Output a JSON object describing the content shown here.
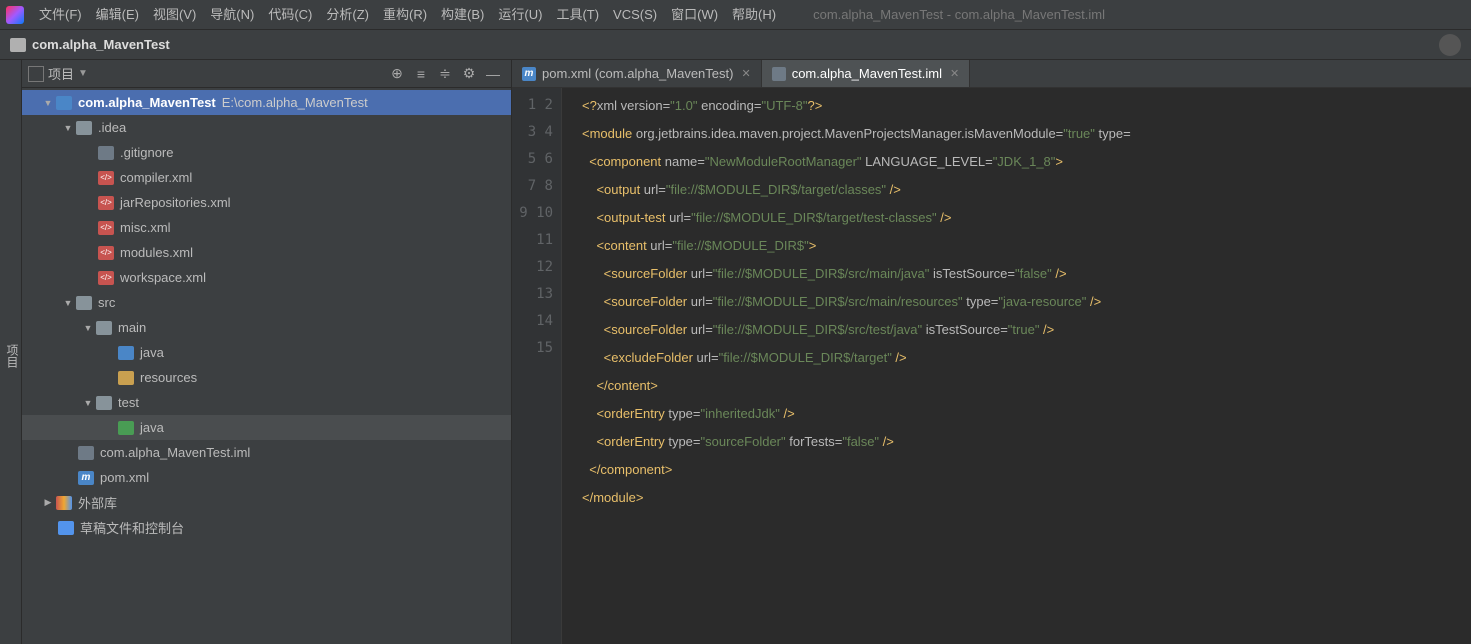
{
  "window_title": "com.alpha_MavenTest - com.alpha_MavenTest.iml",
  "menu": [
    "文件(F)",
    "编辑(E)",
    "视图(V)",
    "导航(N)",
    "代码(C)",
    "分析(Z)",
    "重构(R)",
    "构建(B)",
    "运行(U)",
    "工具(T)",
    "VCS(S)",
    "窗口(W)",
    "帮助(H)"
  ],
  "breadcrumb": "com.alpha_MavenTest",
  "sidebar": {
    "header_label": "项目",
    "gutter_label": "项目"
  },
  "tree": {
    "root_label": "com.alpha_MavenTest",
    "root_path": "E:\\com.alpha_MavenTest",
    "idea": ".idea",
    "gitignore": ".gitignore",
    "compiler": "compiler.xml",
    "jarrepo": "jarRepositories.xml",
    "misc": "misc.xml",
    "modules": "modules.xml",
    "workspace": "workspace.xml",
    "src": "src",
    "main": "main",
    "java": "java",
    "resources": "resources",
    "test": "test",
    "java2": "java",
    "iml": "com.alpha_MavenTest.iml",
    "pom": "pom.xml",
    "ext_lib": "外部库",
    "scratch": "草稿文件和控制台"
  },
  "tabs": {
    "t1": "pom.xml (com.alpha_MavenTest)",
    "t2": "com.alpha_MavenTest.iml"
  },
  "code_lines": 15,
  "code": {
    "l1": {
      "a": "<?",
      "b": "xml version",
      "c": "=",
      "d": "\"1.0\"",
      "e": " encoding",
      "f": "=",
      "g": "\"UTF-8\"",
      "h": "?>"
    },
    "l2": {
      "a": "<module ",
      "b": "org.jetbrains.idea.maven.project.MavenProjectsManager.isMavenModule",
      "c": "=",
      "d": "\"true\"",
      "e": " type",
      "f": "="
    },
    "l3": {
      "a": "  <component ",
      "b": "name",
      "c": "=",
      "d": "\"NewModuleRootManager\"",
      "e": " LANGUAGE_LEVEL",
      "f": "=",
      "g": "\"JDK_1_8\"",
      "h": ">"
    },
    "l4": {
      "a": "    <output ",
      "b": "url",
      "c": "=",
      "d": "\"file://$MODULE_DIR$/target/classes\"",
      "e": " />"
    },
    "l5": {
      "a": "    <output-test ",
      "b": "url",
      "c": "=",
      "d": "\"file://$MODULE_DIR$/target/test-classes\"",
      "e": " />"
    },
    "l6": {
      "a": "    <content ",
      "b": "url",
      "c": "=",
      "d": "\"file://$MODULE_DIR$\"",
      "e": ">"
    },
    "l7": {
      "a": "      <sourceFolder ",
      "b": "url",
      "c": "=",
      "d": "\"file://$MODULE_DIR$/src/main/java\"",
      "e": " isTestSource",
      "f": "=",
      "g": "\"false\"",
      "h": " />"
    },
    "l8": {
      "a": "      <sourceFolder ",
      "b": "url",
      "c": "=",
      "d": "\"file://$MODULE_DIR$/src/main/resources\"",
      "e": " type",
      "f": "=",
      "g": "\"java-resource\"",
      "h": " />"
    },
    "l9": {
      "a": "      <sourceFolder ",
      "b": "url",
      "c": "=",
      "d": "\"file://$MODULE_DIR$/src/test/java\"",
      "e": " isTestSource",
      "f": "=",
      "g": "\"true\"",
      "h": " />"
    },
    "l10": {
      "a": "      <excludeFolder ",
      "b": "url",
      "c": "=",
      "d": "\"file://$MODULE_DIR$/target\"",
      "e": " />"
    },
    "l11": {
      "a": "    </content>"
    },
    "l12": {
      "a": "    <orderEntry ",
      "b": "type",
      "c": "=",
      "d": "\"inheritedJdk\"",
      "e": " />"
    },
    "l13": {
      "a": "    <orderEntry ",
      "b": "type",
      "c": "=",
      "d": "\"sourceFolder\"",
      "e": " forTests",
      "f": "=",
      "g": "\"false\"",
      "h": " />"
    },
    "l14": {
      "a": "  </component>"
    },
    "l15": {
      "a": "</module>"
    }
  }
}
